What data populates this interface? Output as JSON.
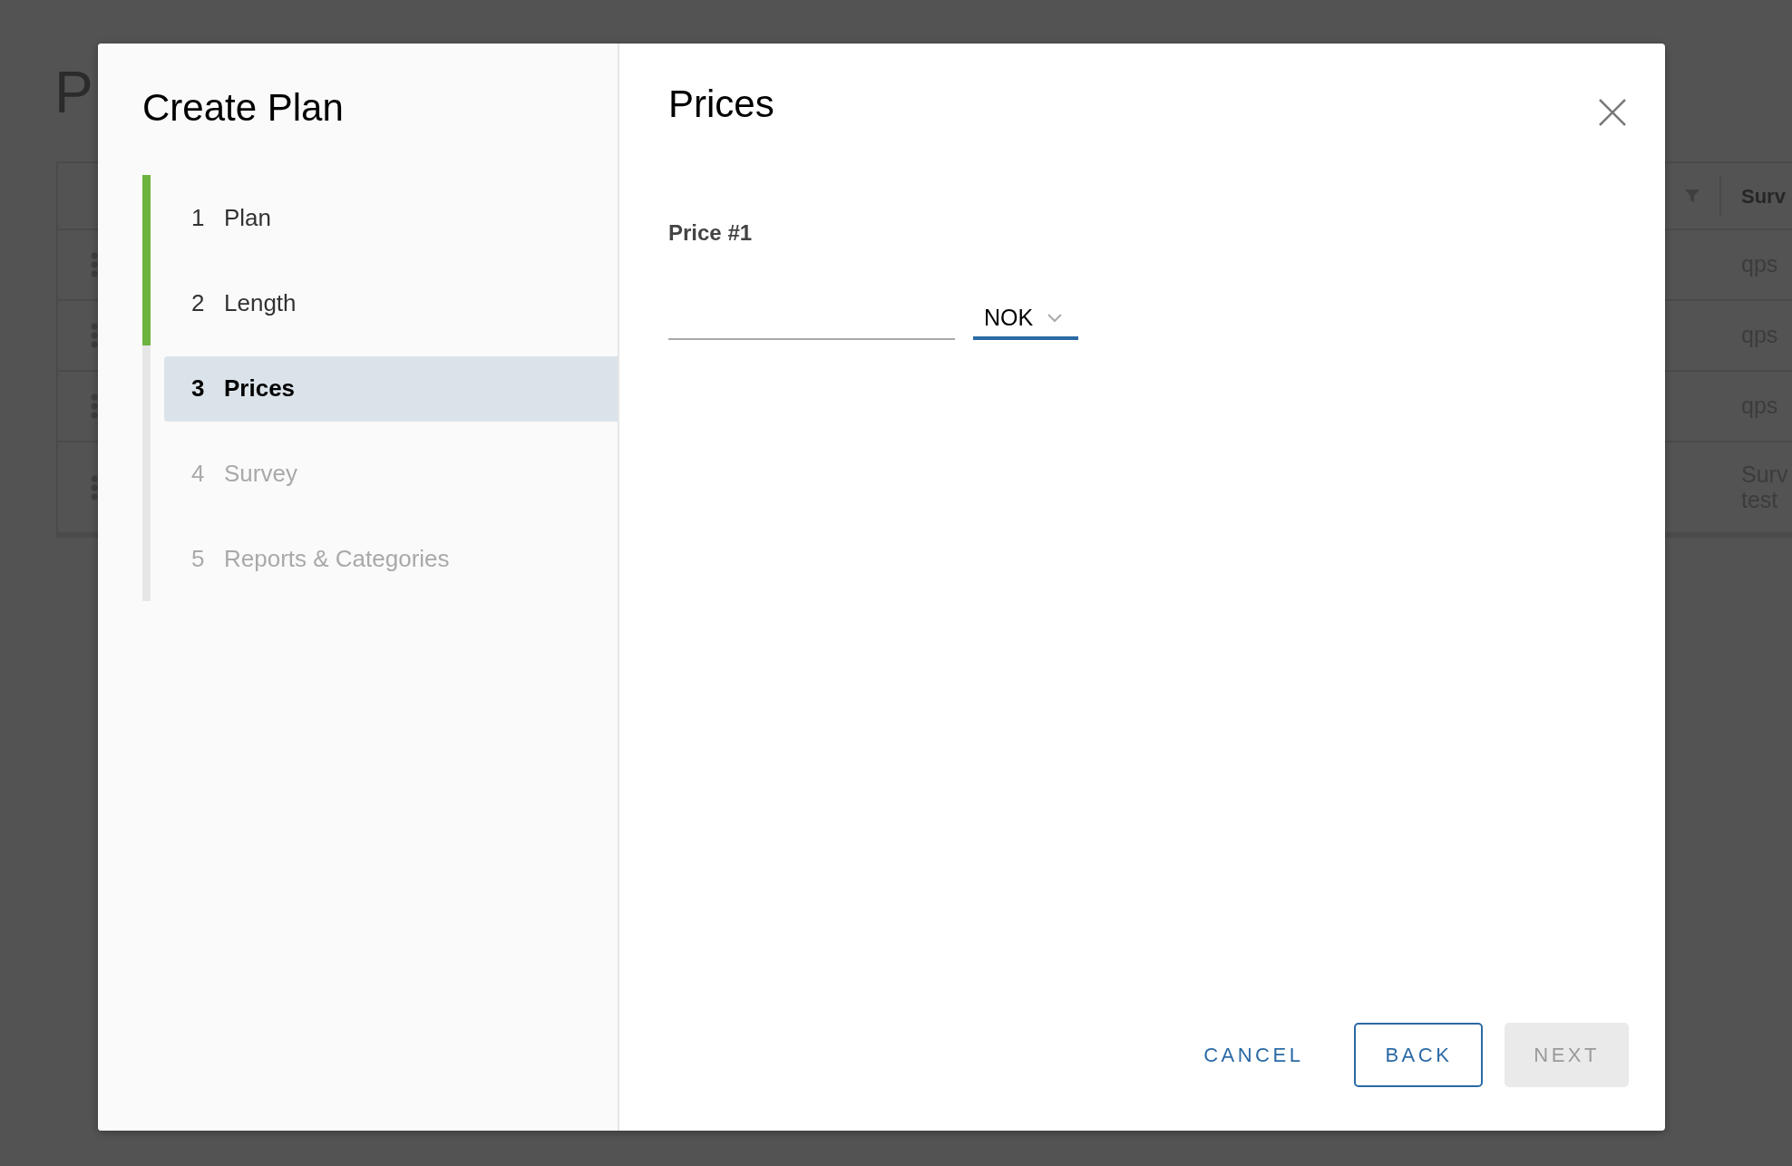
{
  "background": {
    "title": "P",
    "table": {
      "columns": [
        {
          "label": "Surv"
        }
      ],
      "rows": [
        {
          "lines": [
            "qps"
          ]
        },
        {
          "lines": [
            "qps"
          ]
        },
        {
          "lines": [
            "qps"
          ]
        },
        {
          "lines": [
            "Surv",
            "test"
          ]
        }
      ]
    }
  },
  "modal": {
    "title": "Create Plan",
    "steps": [
      {
        "number": "1",
        "label": "Plan",
        "completed": true,
        "disabled": false,
        "selected": false
      },
      {
        "number": "2",
        "label": "Length",
        "completed": true,
        "disabled": false,
        "selected": false
      },
      {
        "number": "3",
        "label": "Prices",
        "completed": false,
        "disabled": false,
        "selected": true
      },
      {
        "number": "4",
        "label": "Survey",
        "completed": false,
        "disabled": true,
        "selected": false
      },
      {
        "number": "5",
        "label": "Reports & Categories",
        "completed": false,
        "disabled": true,
        "selected": false
      }
    ],
    "heading": "Prices",
    "price": {
      "label": "Price #1",
      "currency": "NOK"
    },
    "buttons": [
      {
        "label": "CANCEL",
        "kind": "link",
        "disabled": false
      },
      {
        "label": "BACK",
        "kind": "outline",
        "disabled": false
      },
      {
        "label": "NEXT",
        "kind": "solid",
        "disabled": true
      }
    ]
  }
}
